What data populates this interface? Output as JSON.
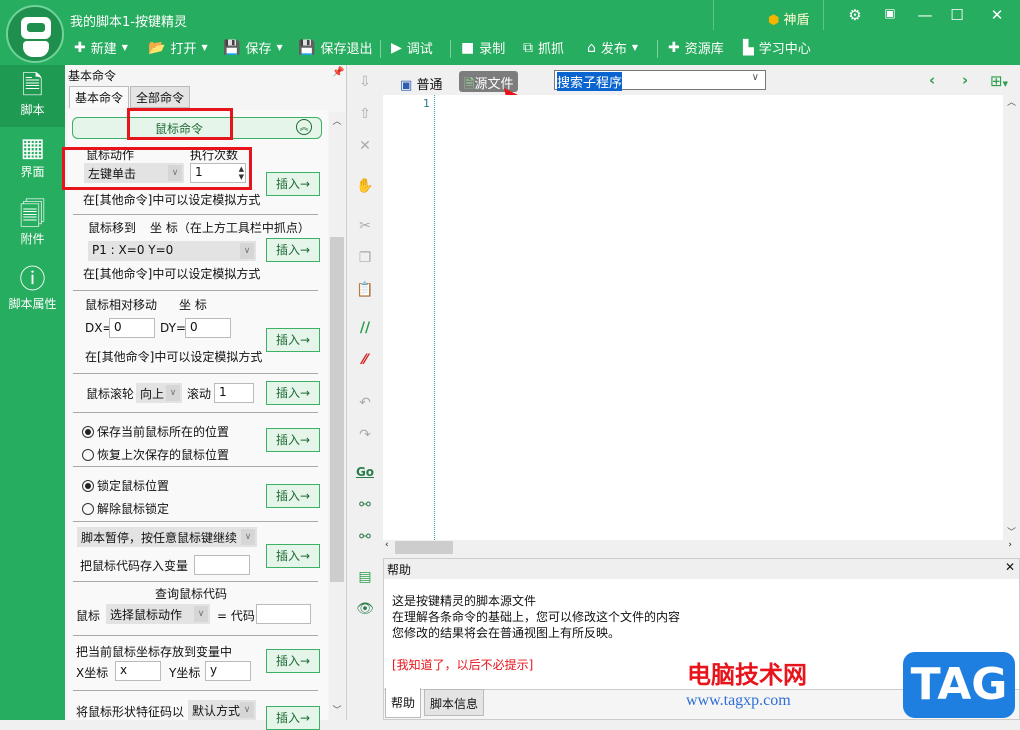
{
  "window": {
    "title": "我的脚本1-按键精灵",
    "shield": "神盾"
  },
  "toolbar": [
    {
      "label": "新建",
      "icon": "plus-icon"
    },
    {
      "label": "打开",
      "icon": "folder-icon"
    },
    {
      "label": "保存",
      "icon": "save-icon"
    },
    {
      "label": "保存退出",
      "icon": "save-exit-icon"
    },
    {
      "label": "调试",
      "icon": "play-icon"
    },
    {
      "label": "录制",
      "icon": "camera-icon"
    },
    {
      "label": "抓抓",
      "icon": "grab-icon"
    },
    {
      "label": "发布",
      "icon": "publish-icon"
    },
    {
      "label": "资源库",
      "icon": "resource-icon"
    },
    {
      "label": "学习中心",
      "icon": "book-icon"
    }
  ],
  "nav": [
    {
      "label": "脚本"
    },
    {
      "label": "界面"
    },
    {
      "label": "附件"
    },
    {
      "label": "脚本属性"
    }
  ],
  "panel": {
    "title": "基本命令",
    "tabs": [
      "基本命令",
      "全部命令"
    ],
    "section": "鼠标命令",
    "mouse_action_label": "鼠标动作",
    "exec_count_label": "执行次数",
    "mouse_action": "左键单击",
    "exec_count": "1",
    "hint": "在[其他命令]中可以设定模拟方式",
    "move_label": "鼠标移到",
    "coord_label": "坐 标（在上方工具栏中抓点）",
    "point": "P1 : X=0 Y=0",
    "rel_label": "鼠标相对移动",
    "rel_coord": "坐 标",
    "dx_label": "DX=",
    "dx": "0",
    "dy_label": "DY=",
    "dy": "0",
    "wheel_label": "鼠标滚轮",
    "wheel_dir": "向上",
    "scroll_label": "滚动",
    "scroll": "1",
    "save_pos": "保存当前鼠标所在的位置",
    "restore_pos": "恢复上次保存的鼠标位置",
    "lock": "锁定鼠标位置",
    "unlock": "解除鼠标锁定",
    "pause": "脚本暂停，按任意鼠标键继续",
    "store_code": "把鼠标代码存入变量",
    "query_title": "查询鼠标代码",
    "mouse": "鼠标",
    "choose": "选择鼠标动作",
    "eq_code": "= 代码",
    "store_coord": "把当前鼠标坐标存放到变量中",
    "x_label": "X坐标",
    "x": "x",
    "y_label": "Y坐标",
    "y": "y",
    "shape": "将鼠标形状特征码以",
    "shape_mode": "默认方式",
    "insert": "插入→"
  },
  "editor": {
    "view_normal": "普通",
    "view_source": "源文件",
    "search": "搜索子程序",
    "line": "1"
  },
  "help": {
    "title": "帮助",
    "lines": [
      "这是按键精灵的脚本源文件",
      "在理解各条命令的基础上，您可以修改这个文件的内容",
      "您修改的结果将会在普通视图上有所反映。"
    ],
    "dismiss": "[我知道了，以后不必提示]",
    "tabs": [
      "帮助",
      "脚本信息"
    ]
  },
  "watermark": {
    "site": "电脑技术网",
    "url": "www.tagxp.com",
    "tag": "TAG"
  }
}
